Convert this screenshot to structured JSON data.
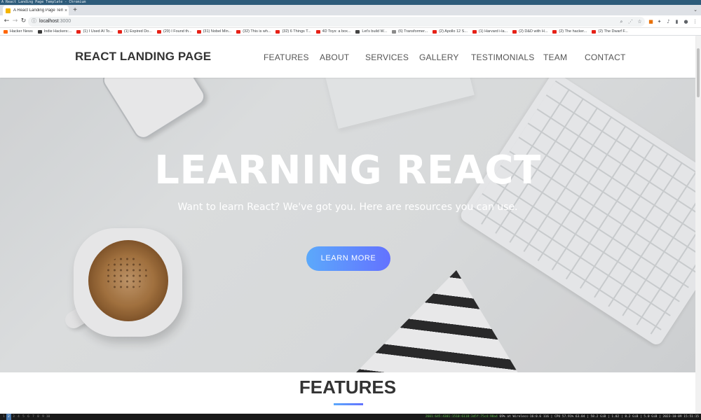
{
  "os": {
    "title_text": "A React Landing Page Template - Chromium",
    "workspaces": [
      "1",
      "2",
      "3",
      "4",
      "5",
      "6",
      "7",
      "8",
      "9",
      "10"
    ],
    "status_ip": "2601:645:4301:1510:6118:3d5f:75c4:98a4",
    "status_text": "69% at Wireless-16:0.6 116 | CPU 57.91% 63.04 | 58.2 GiB | 1.02 | 8.2 GiB | 5.0 GiB | 2023-10-09 15:51:15"
  },
  "browser": {
    "tab": {
      "title": "A React Landing Page Tem",
      "close": "×"
    },
    "new_tab": "+",
    "url_host": "localhost",
    "url_port": ":3000",
    "bookmarks": [
      {
        "label": "Hacker News",
        "icon": "hn"
      },
      {
        "label": "Indie Hackers:...",
        "icon": "ih"
      },
      {
        "label": "(1) I Used AI To...",
        "icon": "yt"
      },
      {
        "label": "(1) Expired Do...",
        "icon": "yt"
      },
      {
        "label": "(29) I Found th...",
        "icon": "yt"
      },
      {
        "label": "(31) Nobel Min...",
        "icon": "yt"
      },
      {
        "label": "(32) This is wh...",
        "icon": "yt"
      },
      {
        "label": "(32) 6 Things T...",
        "icon": "yt"
      },
      {
        "label": "4D Toys: a box...",
        "icon": "yt"
      },
      {
        "label": "Let's build W...",
        "icon": "gh"
      },
      {
        "label": "(6) Transformer...",
        "icon": "gen"
      },
      {
        "label": "(2) Apollo 12 S...",
        "icon": "yt"
      },
      {
        "label": "(1) Harvard i-la...",
        "icon": "yt"
      },
      {
        "label": "(2) D&D with H...",
        "icon": "yt"
      },
      {
        "label": "(2) The hacker...",
        "icon": "yt"
      },
      {
        "label": "(2) The Dwarf F...",
        "icon": "yt"
      }
    ]
  },
  "site": {
    "brand": "REACT LANDING PAGE",
    "menu": [
      "FEATURES",
      "ABOUT",
      "SERVICES",
      "GALLERY",
      "TESTIMONIALS",
      "TEAM",
      "CONTACT"
    ],
    "hero": {
      "title": "LEARNING REACT",
      "subtitle": "Want to learn React? We've got you. Here are resources you can use.",
      "button": "LEARN MORE"
    },
    "features_title": "FEATURES"
  },
  "colors": {
    "accent_start": "#5ca9fb",
    "accent_end": "#6372ff",
    "heading": "#333333"
  }
}
